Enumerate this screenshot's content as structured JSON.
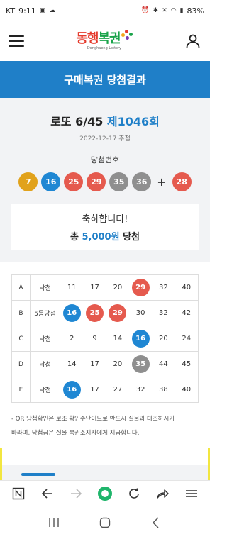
{
  "status": {
    "carrier": "KT",
    "time": "9:11",
    "battery": "83%"
  },
  "header": {
    "logo_text_red": "동행",
    "logo_text_green": "복권",
    "logo_sub": "Donghaeng Lottery"
  },
  "title": "구매복권 당첨결과",
  "draw": {
    "game": "로또 6/45",
    "round": "제1046회",
    "date": "2022-12-17 추첨",
    "win_label": "당첨번호",
    "numbers": [
      {
        "n": "7",
        "color": "#e1a21b"
      },
      {
        "n": "16",
        "color": "#1f87d3"
      },
      {
        "n": "25",
        "color": "#e55a4e"
      },
      {
        "n": "29",
        "color": "#e55a4e"
      },
      {
        "n": "35",
        "color": "#8f8f8f"
      },
      {
        "n": "36",
        "color": "#8f8f8f"
      }
    ],
    "plus": "+",
    "bonus": {
      "n": "28",
      "color": "#e55a4e"
    }
  },
  "result": {
    "congrats": "축하합니다!",
    "prefix": "총",
    "amount": "5,000원",
    "suffix": "당첨"
  },
  "ticket": {
    "rows": [
      {
        "label": "A",
        "result": "낙첨",
        "nums": [
          {
            "n": "11",
            "hit": false
          },
          {
            "n": "17",
            "hit": false
          },
          {
            "n": "20",
            "hit": false
          },
          {
            "n": "29",
            "hit": true,
            "color": "#e55a4e"
          },
          {
            "n": "32",
            "hit": false
          },
          {
            "n": "40",
            "hit": false
          }
        ]
      },
      {
        "label": "B",
        "result": "5등당첨",
        "nums": [
          {
            "n": "16",
            "hit": true,
            "color": "#1f87d3"
          },
          {
            "n": "25",
            "hit": true,
            "color": "#e55a4e"
          },
          {
            "n": "29",
            "hit": true,
            "color": "#e55a4e"
          },
          {
            "n": "30",
            "hit": false
          },
          {
            "n": "32",
            "hit": false
          },
          {
            "n": "42",
            "hit": false
          }
        ]
      },
      {
        "label": "C",
        "result": "낙첨",
        "nums": [
          {
            "n": "2",
            "hit": false
          },
          {
            "n": "9",
            "hit": false
          },
          {
            "n": "14",
            "hit": false
          },
          {
            "n": "16",
            "hit": true,
            "color": "#1f87d3"
          },
          {
            "n": "20",
            "hit": false
          },
          {
            "n": "24",
            "hit": false
          }
        ]
      },
      {
        "label": "D",
        "result": "낙첨",
        "nums": [
          {
            "n": "14",
            "hit": false
          },
          {
            "n": "17",
            "hit": false
          },
          {
            "n": "20",
            "hit": false
          },
          {
            "n": "35",
            "hit": true,
            "color": "#8f8f8f"
          },
          {
            "n": "44",
            "hit": false
          },
          {
            "n": "45",
            "hit": false
          }
        ]
      },
      {
        "label": "E",
        "result": "낙첨",
        "nums": [
          {
            "n": "16",
            "hit": true,
            "color": "#1f87d3"
          },
          {
            "n": "17",
            "hit": false
          },
          {
            "n": "27",
            "hit": false
          },
          {
            "n": "32",
            "hit": false
          },
          {
            "n": "38",
            "hit": false
          },
          {
            "n": "40",
            "hit": false
          }
        ]
      }
    ]
  },
  "notice": {
    "line1": "- QR 당첨확인은 보조 확인수단이므로 반드시 실물과 대조하시기",
    "line2": "바라며, 당첨금은 실물 복권소지자에게 지급합니다."
  },
  "colors": {
    "brand_blue": "#1f7fc8",
    "win_red": "#e55a4e",
    "win_blue": "#1f87d3",
    "win_gray": "#8f8f8f",
    "win_yellow": "#e1a21b"
  },
  "icons": {
    "menu": "hamburger-icon",
    "user": "user-icon",
    "browser": [
      "reader-mode-icon",
      "back-icon",
      "forward-icon",
      "home-icon",
      "refresh-icon",
      "share-icon",
      "more-menu-icon"
    ],
    "nav": [
      "recent-apps-icon",
      "home-nav-icon",
      "back-nav-icon"
    ]
  }
}
